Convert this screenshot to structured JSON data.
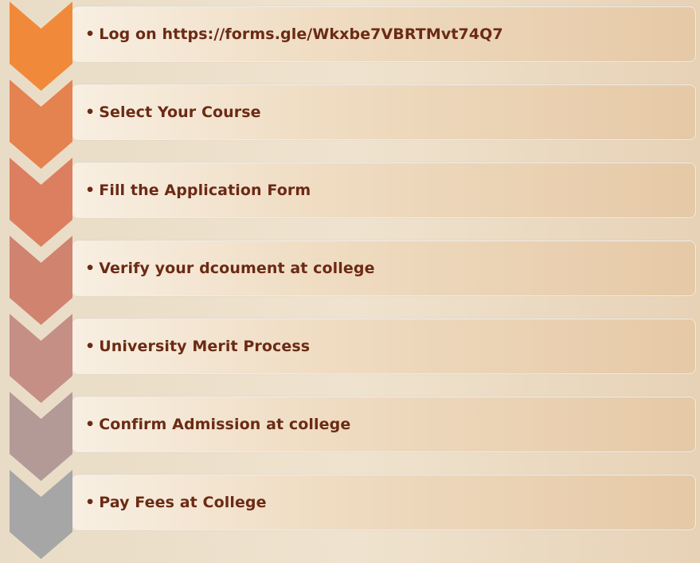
{
  "steps": [
    {
      "label": "Log on  https://forms.gle/Wkxbe7VBRTMvt74Q7",
      "color": "#f08a3a"
    },
    {
      "label": "Select Your Course",
      "color": "#e48350"
    },
    {
      "label": "Fill the Application Form",
      "color": "#dc7f60"
    },
    {
      "label": "Verify your dcoument at college",
      "color": "#d0836f"
    },
    {
      "label": "University Merit Process",
      "color": "#c58f86"
    },
    {
      "label": "Confirm Admission at college",
      "color": "#b49a96"
    },
    {
      "label": "Pay Fees at College",
      "color": "#a6a6a6"
    }
  ]
}
